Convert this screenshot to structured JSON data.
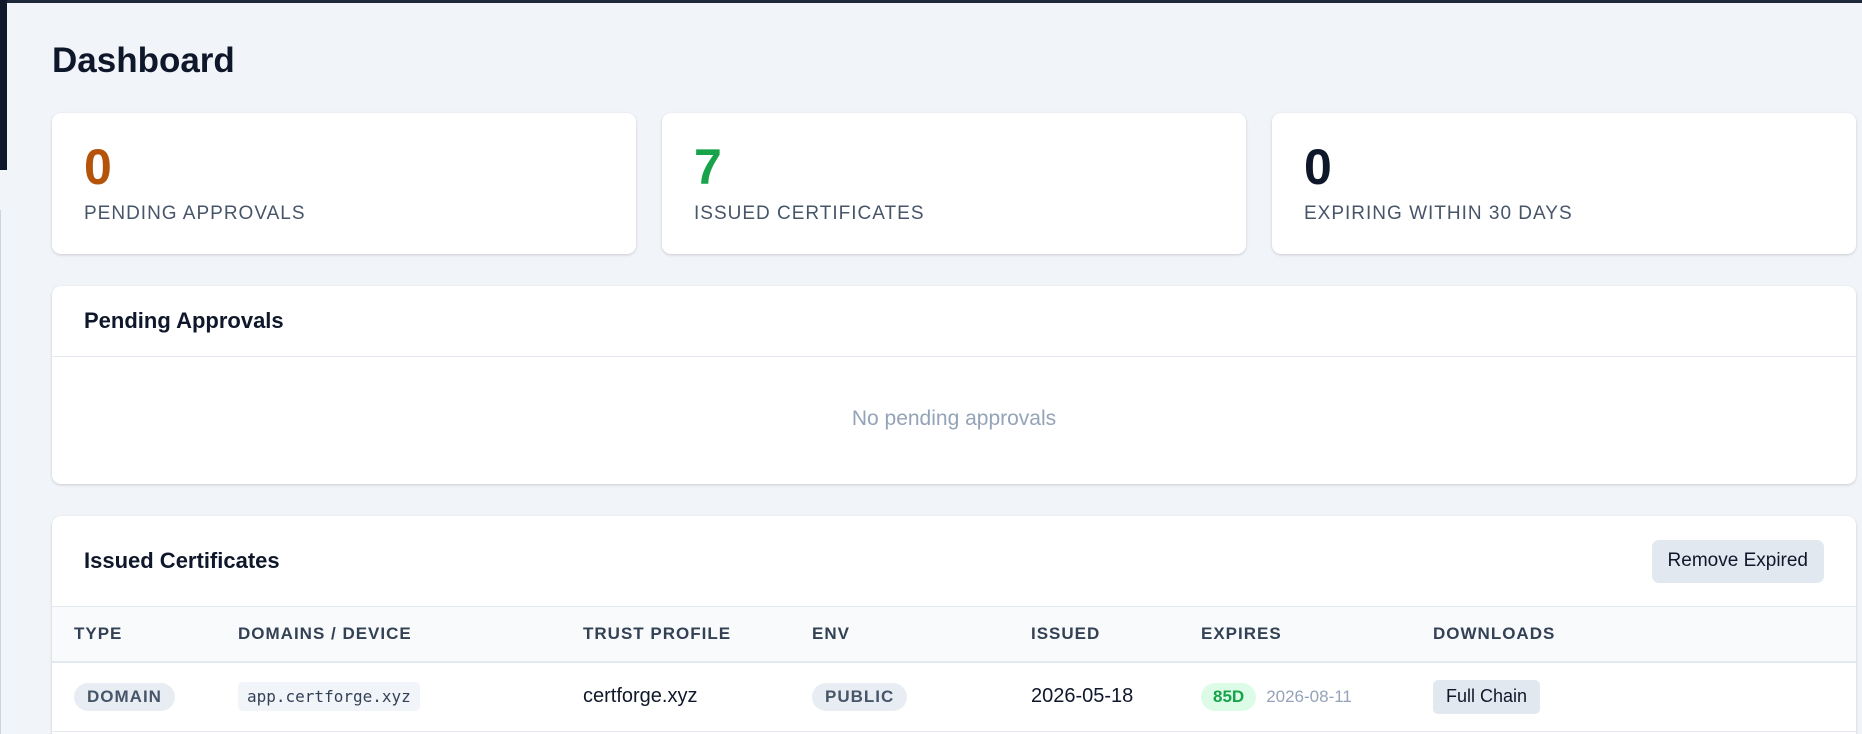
{
  "page": {
    "title": "Dashboard"
  },
  "stats": [
    {
      "value": "0",
      "label": "PENDING APPROVALS",
      "color": "#b45309"
    },
    {
      "value": "7",
      "label": "ISSUED CERTIFICATES",
      "color": "#16a34a"
    },
    {
      "value": "0",
      "label": "EXPIRING WITHIN 30 DAYS",
      "color": "#0f172a"
    }
  ],
  "pending": {
    "title": "Pending Approvals",
    "empty_message": "No pending approvals"
  },
  "issued": {
    "title": "Issued Certificates",
    "remove_expired_label": "Remove Expired",
    "columns": [
      "TYPE",
      "DOMAINS / DEVICE",
      "TRUST PROFILE",
      "ENV",
      "ISSUED",
      "EXPIRES",
      "DOWNLOADS"
    ],
    "rows": [
      {
        "type": "DOMAIN",
        "domain": "app.certforge.xyz",
        "trust_profile": "certforge.xyz",
        "env": "PUBLIC",
        "issued": "2026-05-18",
        "expires_days": "85D",
        "expires_date": "2026-08-11",
        "download_label": "Full Chain"
      }
    ]
  },
  "colors": {
    "accent_days": "#16a34a",
    "background": "#f1f4f8"
  }
}
